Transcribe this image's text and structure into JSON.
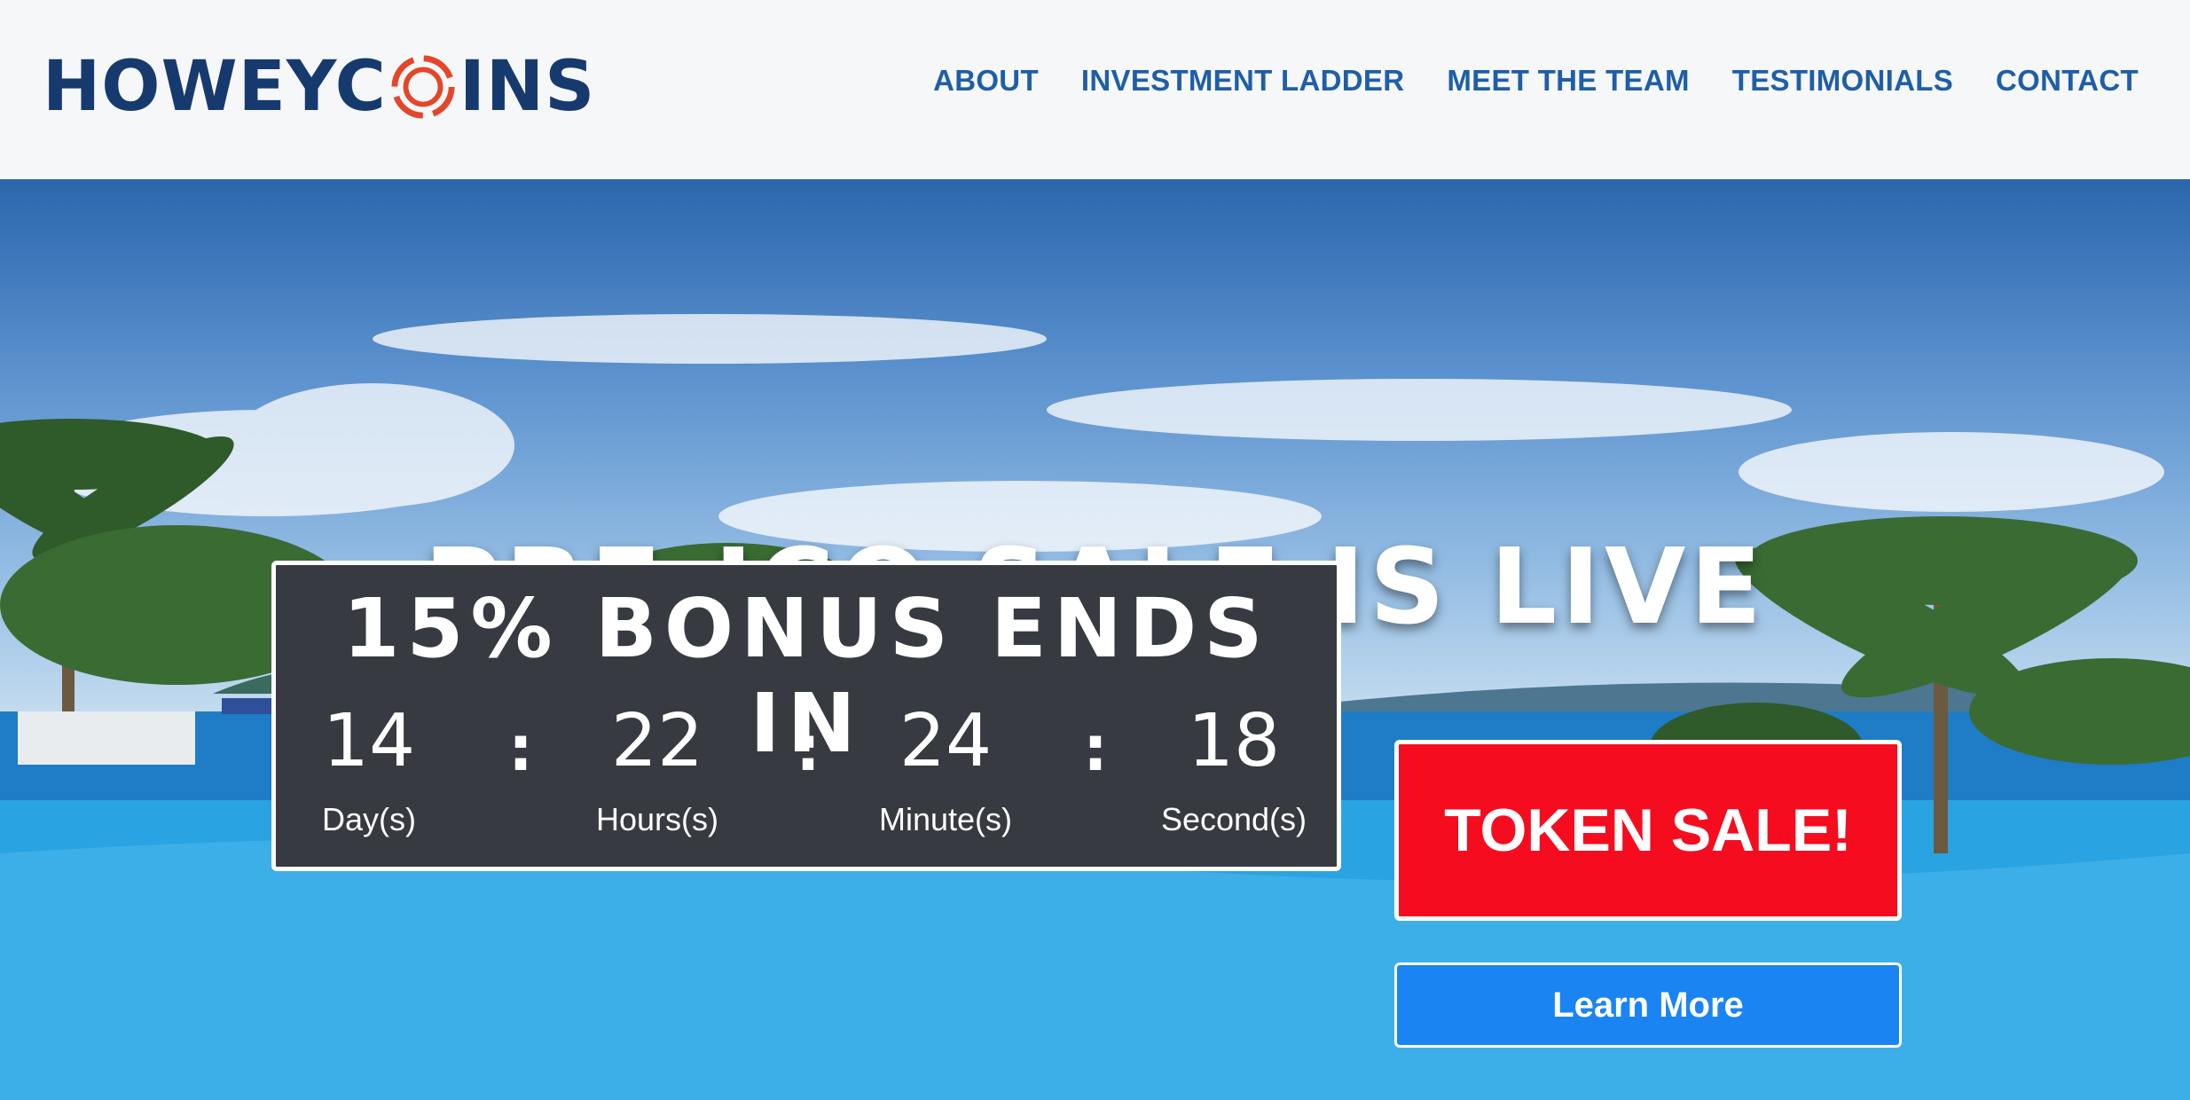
{
  "brand": {
    "logo_text_left": "HOWEYC",
    "logo_text_right": "INS",
    "logo_alt": "HOWEYCOINS",
    "colors": {
      "navy": "#173a6e",
      "accent": "#e4462a",
      "nav_link": "#1f5ea8"
    }
  },
  "nav": {
    "items": [
      {
        "label": "ABOUT"
      },
      {
        "label": "INVESTMENT LADDER"
      },
      {
        "label": "MEET THE TEAM"
      },
      {
        "label": "TESTIMONIALS"
      },
      {
        "label": "CONTACT"
      }
    ]
  },
  "hero": {
    "headline": "PRE-ICO SALE IS LIVE",
    "countdown": {
      "title": "15% BONUS ENDS IN",
      "separator": ":",
      "units": [
        {
          "value": "14",
          "label": "Day(s)"
        },
        {
          "value": "22",
          "label": "Hours(s)"
        },
        {
          "value": "24",
          "label": "Minute(s)"
        },
        {
          "value": "18",
          "label": "Second(s)"
        }
      ]
    },
    "token_sale_label": "TOKEN SALE!",
    "learn_more_label": "Learn More",
    "colors": {
      "token_sale": "#f50d1f",
      "learn_more": "#1a84f2",
      "countdown_bg": "#373a40"
    }
  }
}
